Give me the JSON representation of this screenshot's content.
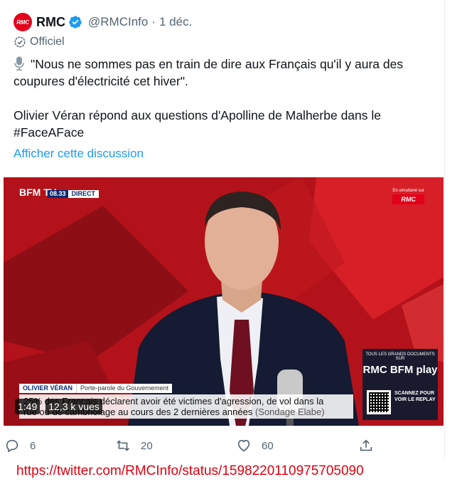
{
  "tweet": {
    "avatar_text": "RMC",
    "display_name": "RMC",
    "handle": "@RMCInfo",
    "separator": "·",
    "date": "1 déc.",
    "official_label": "Officiel",
    "text_lines": [
      "\"Nous ne sommes pas en train de dire aux Français qu'il y aura des",
      "coupures d'électricité cet hiver\".",
      "Olivier Véran répond aux questions d'Apolline de Malherbe dans le",
      "#FaceAFace"
    ],
    "show_thread": "Afficher cette discussion",
    "icons": {
      "verified": "verified-badge-icon",
      "official": "official-check-icon",
      "mic": "microphone-icon"
    },
    "colors": {
      "link": "#1d9bf0",
      "muted": "#536471",
      "brand": "#e2001a"
    }
  },
  "video": {
    "channel_logo": "BFM TV.",
    "clock": "08.33",
    "live_label": "DIRECT",
    "simulcast_label": "En simultané sur",
    "simulcast_brand": "RMC",
    "promo_top": "TOUS LES GRANDS DOCUMENTS SUR",
    "promo_brand": "RMC BFM play",
    "promo_cta": "SCANNEZ POUR VOIR LE REPLAY",
    "guest_name": "OLIVIER VÉRAN",
    "guest_role": "Porte-parole du Gouvernement",
    "ticker_line1": "25% des Français déclarent avoir été victimes d'agression, de vol dans la",
    "ticker_line2": "rue ou de cambriolage au cours des 2 dernières années",
    "ticker_source": "(Sondage Elabe)",
    "duration": "1:49",
    "views": "12,3 k vues"
  },
  "actions": {
    "replies": "6",
    "retweets": "20",
    "likes": "60",
    "icons": [
      "reply-icon",
      "retweet-icon",
      "like-icon",
      "share-icon"
    ]
  },
  "source_url": "https://twitter.com/RMCInfo/status/1598220110975705090"
}
